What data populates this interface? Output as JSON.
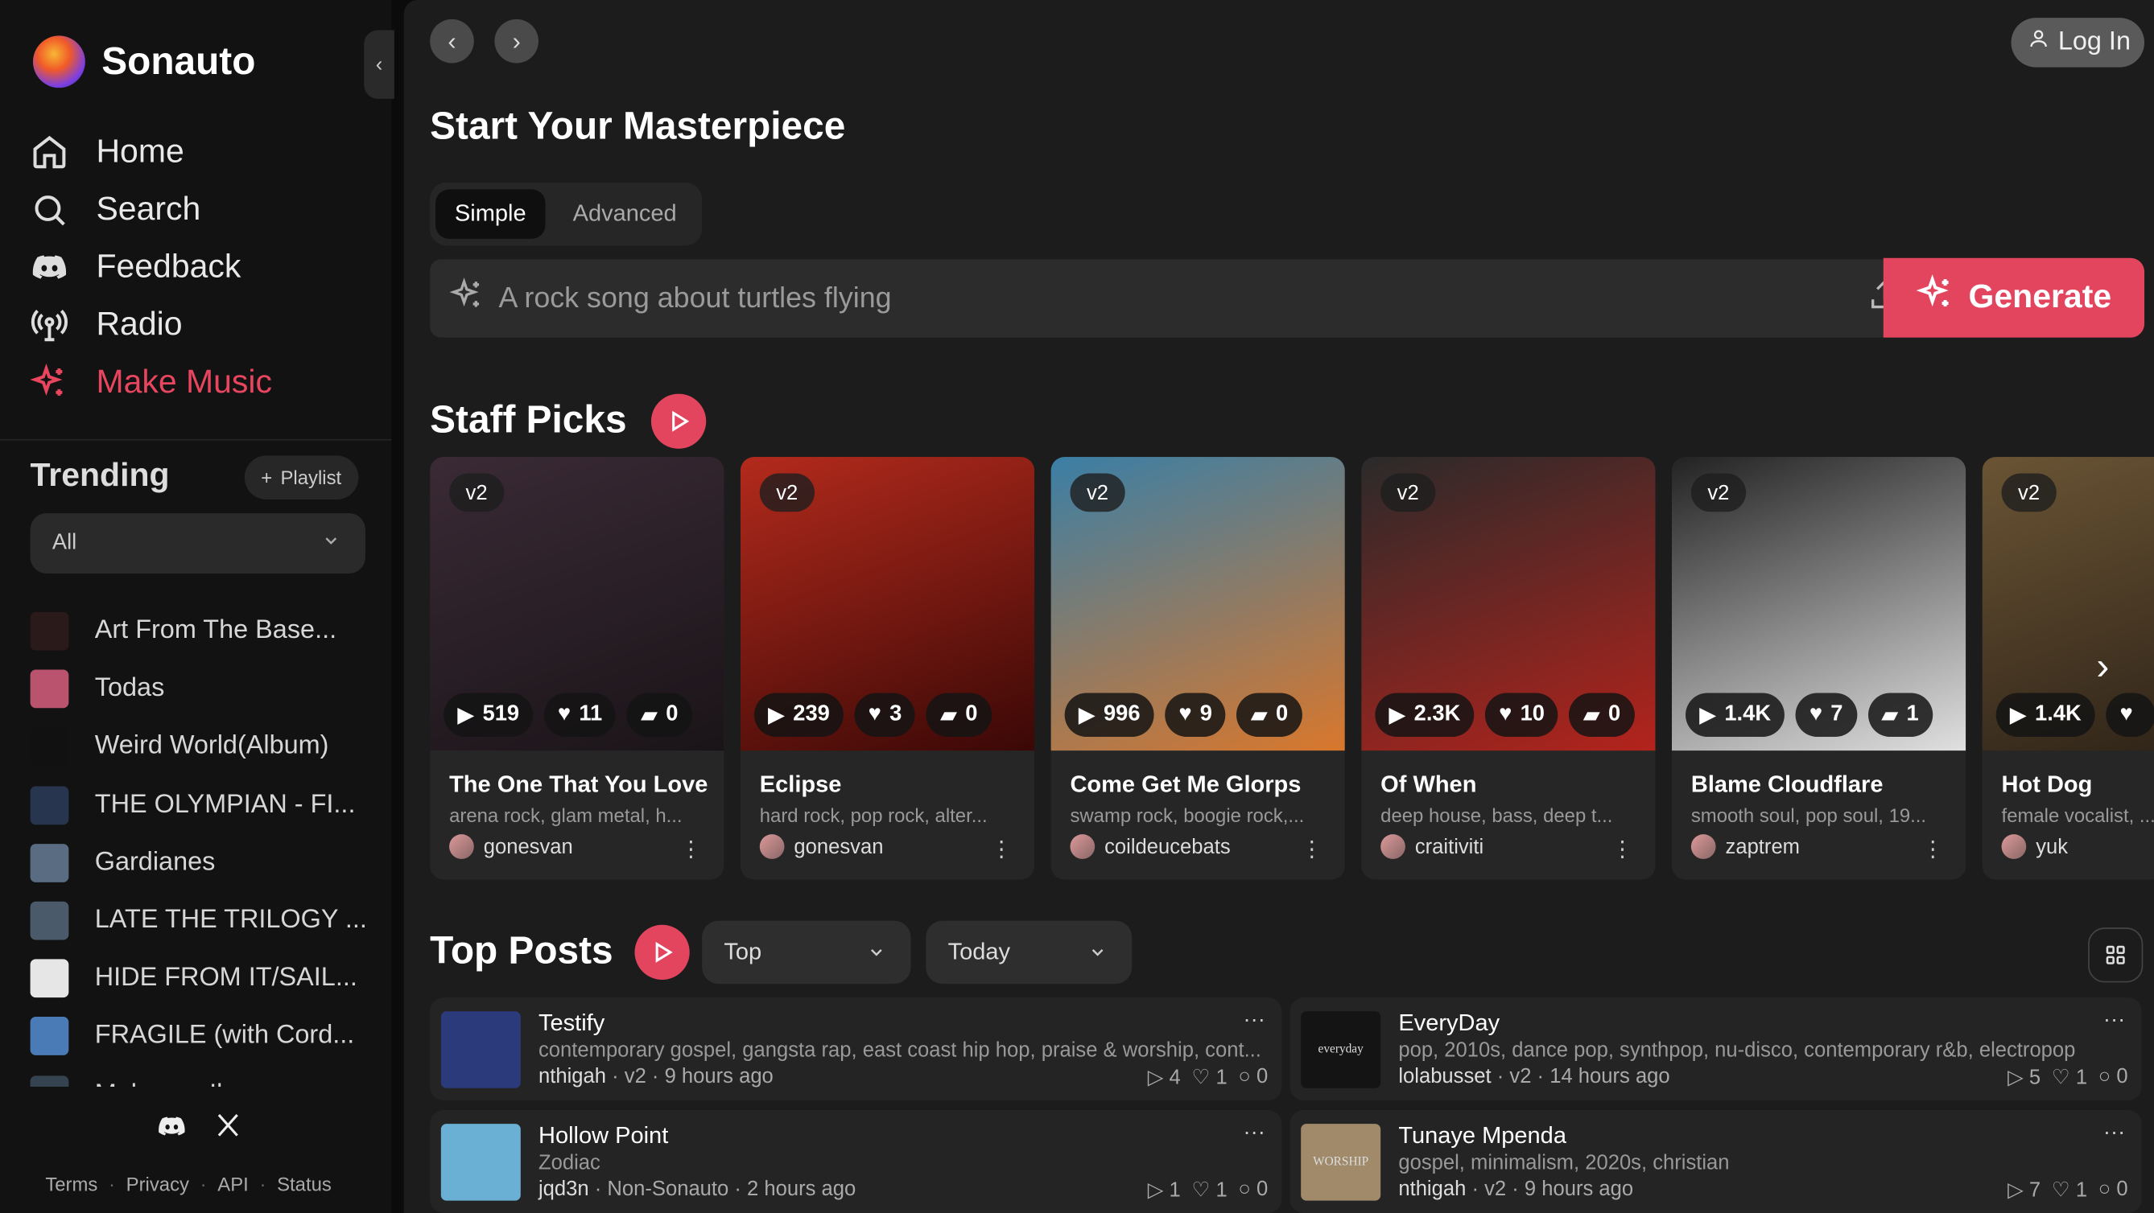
{
  "brand": {
    "name": "Sonauto"
  },
  "nav": [
    {
      "label": "Home",
      "icon": "home-icon"
    },
    {
      "label": "Search",
      "icon": "search-icon"
    },
    {
      "label": "Feedback",
      "icon": "discord-icon"
    },
    {
      "label": "Radio",
      "icon": "radio-icon"
    },
    {
      "label": "Make Music",
      "icon": "sparkle-icon",
      "active": true
    }
  ],
  "trending": {
    "title": "Trending",
    "playlist_button": "Playlist",
    "filter": "All",
    "items": [
      {
        "label": "Art From The Base...",
        "color": "#2a1a1a"
      },
      {
        "label": "Todas",
        "color": "#b9536e"
      },
      {
        "label": "Weird World(Album)",
        "color": "#111111"
      },
      {
        "label": "THE OLYMPIAN - FI...",
        "color": "#27364e"
      },
      {
        "label": "Gardianes",
        "color": "#5a6c82"
      },
      {
        "label": "LATE THE TRILOGY ...",
        "color": "#4a5a6a"
      },
      {
        "label": "HIDE FROM IT/SAIL...",
        "color": "#e6e6e6"
      },
      {
        "label": "FRAGILE (with Cord...",
        "color": "#4a7bb6"
      },
      {
        "label": "Make me Il...",
        "color": "#35424f"
      }
    ]
  },
  "footer": {
    "links": [
      "Terms",
      "Privacy",
      "API",
      "Status"
    ]
  },
  "header": {
    "login": "Log In"
  },
  "composer": {
    "title": "Start Your Masterpiece",
    "tabs": [
      "Simple",
      "Advanced"
    ],
    "active_tab": "Simple",
    "placeholder": "A rock song about turtles flying",
    "generate": "Generate"
  },
  "staff_picks": {
    "title": "Staff Picks",
    "cards": [
      {
        "badge": "v2",
        "plays": "519",
        "likes": "11",
        "comments": "0",
        "title": "The One That You Love",
        "tags": "arena rock, glam metal, h...",
        "user": "gonesvan",
        "art": [
          "#3a2a35",
          "#1a1418"
        ]
      },
      {
        "badge": "v2",
        "plays": "239",
        "likes": "3",
        "comments": "0",
        "title": "Eclipse",
        "tags": "hard rock, pop rock, alter...",
        "user": "gonesvan",
        "art": [
          "#b32a1c",
          "#3a0806"
        ]
      },
      {
        "badge": "v2",
        "plays": "996",
        "likes": "9",
        "comments": "0",
        "title": "Come Get Me Glorps",
        "tags": "swamp rock, boogie rock,...",
        "user": "coildeucebats",
        "art": [
          "#3a7fa6",
          "#d9772c"
        ]
      },
      {
        "badge": "v2",
        "plays": "2.3K",
        "likes": "10",
        "comments": "0",
        "title": "Of When",
        "tags": "deep house, bass, deep t...",
        "user": "craitiviti",
        "art": [
          "#2a2a2a",
          "#b3231c"
        ]
      },
      {
        "badge": "v2",
        "plays": "1.4K",
        "likes": "7",
        "comments": "1",
        "title": "Blame Cloudflare",
        "tags": "smooth soul, pop soul, 19...",
        "user": "zaptrem",
        "art": [
          "#222222",
          "#e0e0e0"
        ]
      },
      {
        "badge": "v2",
        "plays": "1.4K",
        "likes": "",
        "comments": "",
        "title": "Hot Dog",
        "tags": "female vocalist, ...",
        "user": "yuk",
        "art": [
          "#6a5434",
          "#2a2016"
        ]
      }
    ]
  },
  "top_posts": {
    "title": "Top Posts",
    "sort": "Top",
    "range": "Today",
    "posts": [
      {
        "title": "Testify",
        "tags": "contemporary gospel, gangsta rap, east coast hip hop, praise & worship, cont...",
        "user": "nthigah",
        "version": "v2",
        "time": "9 hours ago",
        "plays": "4",
        "likes": "1",
        "comments": "0",
        "thumb": "#2b3a7a"
      },
      {
        "title": "EveryDay",
        "tags": "pop, 2010s, dance pop, synthpop, nu-disco, contemporary r&b, electropop",
        "user": "lolabusset",
        "version": "v2",
        "time": "14 hours ago",
        "plays": "5",
        "likes": "1",
        "comments": "0",
        "thumb": "#141414",
        "thumb_text": "everyday"
      },
      {
        "title": "Hollow Point",
        "tags": "Zodiac",
        "user": "jqd3n",
        "version": "Non-Sonauto",
        "time": "2 hours ago",
        "plays": "1",
        "likes": "1",
        "comments": "0",
        "thumb": "#6ab0d4"
      },
      {
        "title": "Tunaye Mpenda",
        "tags": "gospel, minimalism, 2020s, christian",
        "user": "nthigah",
        "version": "v2",
        "time": "9 hours ago",
        "plays": "7",
        "likes": "1",
        "comments": "0",
        "thumb": "#a08a6a",
        "thumb_text": "WORSHIP"
      }
    ]
  },
  "colors": {
    "accent": "#e4455e",
    "sidebar": "#121212",
    "main": "#1c1c1c"
  }
}
